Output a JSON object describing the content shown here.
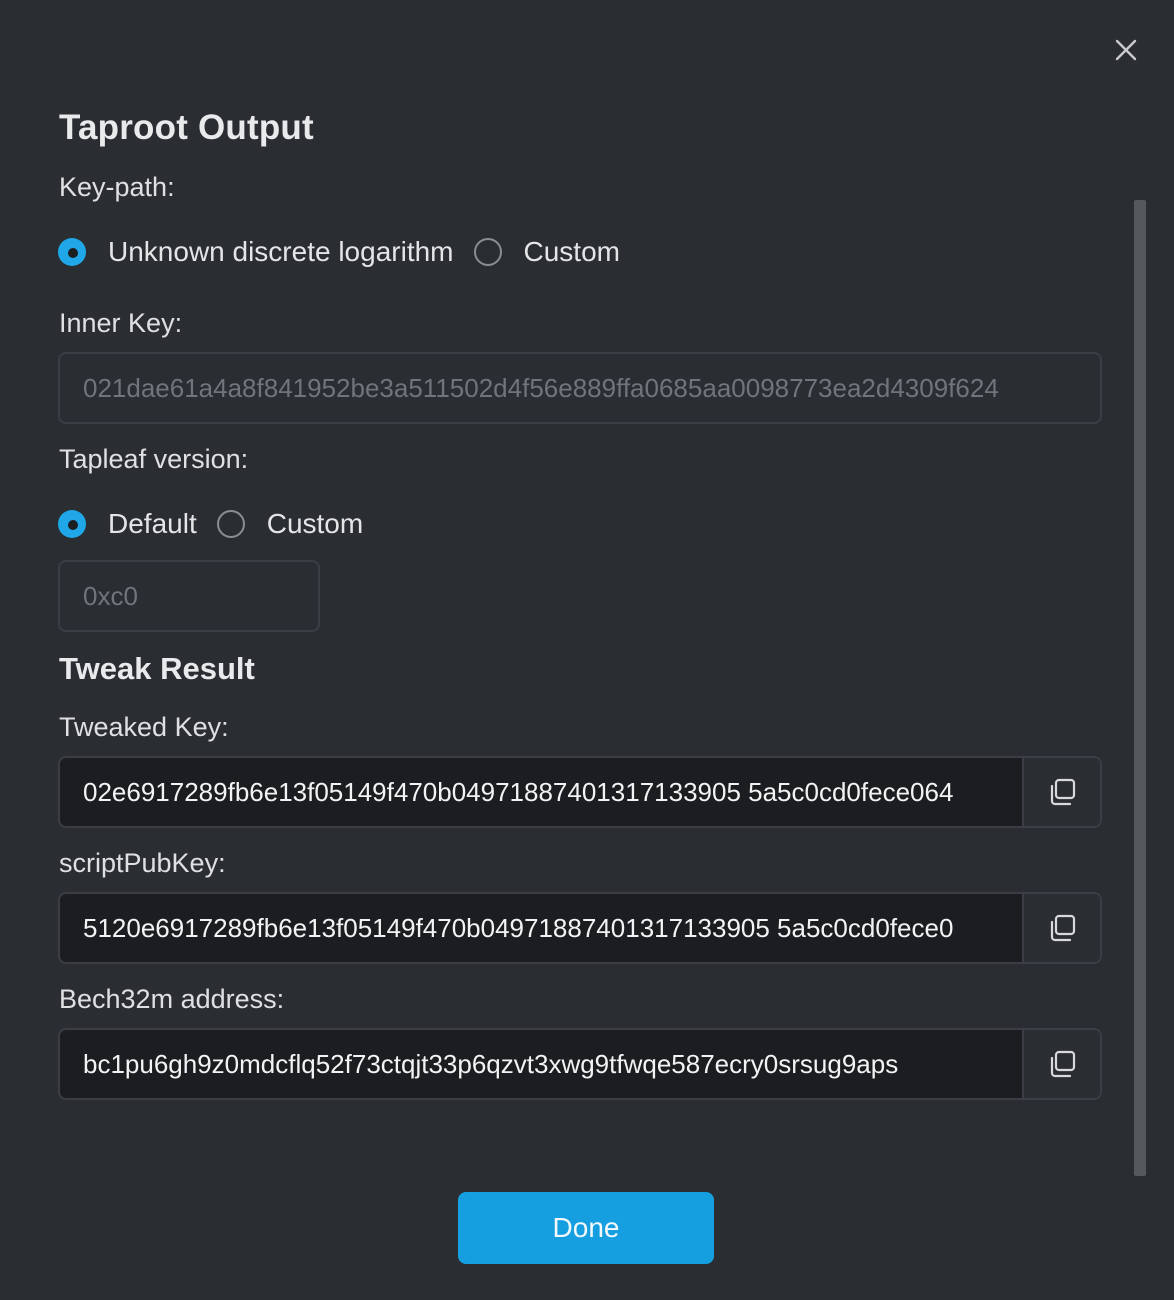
{
  "dialog": {
    "title": "Taproot Output",
    "close_icon": "close-icon"
  },
  "key_path": {
    "label": "Key-path:",
    "options": [
      {
        "label": "Unknown discrete logarithm",
        "checked": true
      },
      {
        "label": "Custom",
        "checked": false
      }
    ]
  },
  "inner_key": {
    "label": "Inner Key:",
    "value": "021dae61a4a8f841952be3a511502d4f56e889ffa0685aa0098773ea2d4309f624"
  },
  "tapleaf_version": {
    "label": "Tapleaf version:",
    "options": [
      {
        "label": "Default",
        "checked": true
      },
      {
        "label": "Custom",
        "checked": false
      }
    ],
    "value": "0xc0"
  },
  "tweak_result": {
    "title": "Tweak Result",
    "tweaked_key": {
      "label": "Tweaked Key:",
      "value": "02e6917289fb6e13f05149f470b04971887401317133905 5a5c0cd0fece064"
    },
    "script_pub_key": {
      "label": "scriptPubKey:",
      "value": "5120e6917289fb6e13f05149f470b04971887401317133905 5a5c0cd0fece0"
    },
    "bech32m_address": {
      "label": "Bech32m address:",
      "value": "bc1pu6gh9z0mdcflq52f73ctqjt33p6qzvt3xwg9tfwqe587ecry0srsug9aps"
    },
    "copy_icon": "copy-icon"
  },
  "footer": {
    "done_label": "Done"
  },
  "colors": {
    "background": "#2a2d32",
    "accent": "#1fa7e8",
    "button": "#159fe0",
    "field_dark": "#1b1d21"
  }
}
